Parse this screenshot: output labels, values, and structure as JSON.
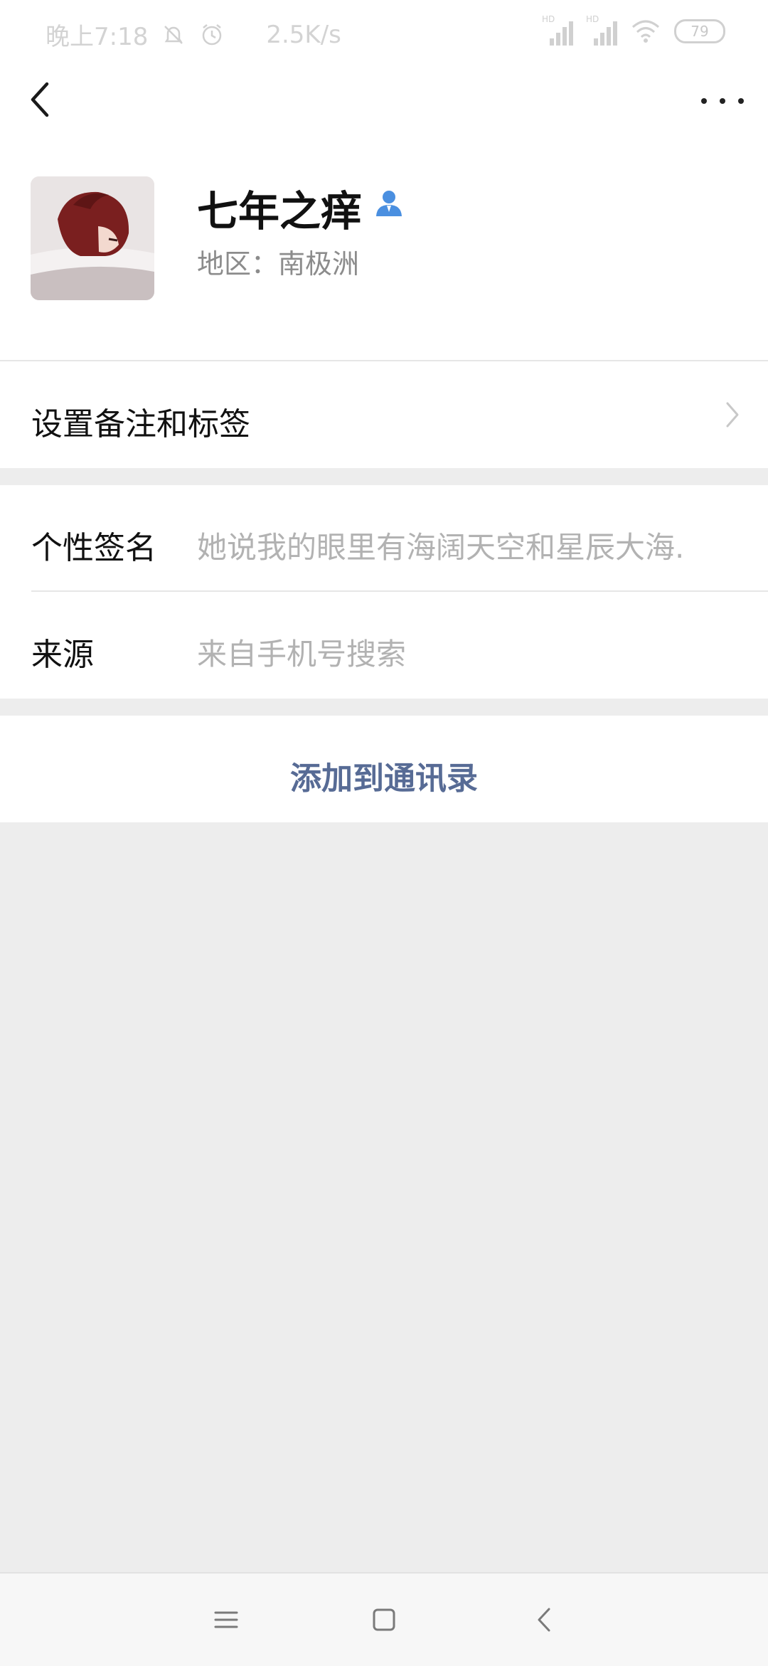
{
  "status_bar": {
    "time": "晚上7:18",
    "net_speed": "2.5K/s",
    "signal_1_label": "HD",
    "signal_2_label": "HD",
    "battery": "79",
    "icons": [
      "mute-bell-icon",
      "alarm-icon",
      "signal-icon",
      "wifi-icon",
      "battery-icon"
    ]
  },
  "header": {
    "back_icon": "chevron-left-icon",
    "more_icon": "more-dots-icon"
  },
  "profile": {
    "name": "七年之痒",
    "region": "地区：南极洲",
    "badge_icon": "person-icon",
    "avatar": "avatar-image"
  },
  "cells": {
    "remark_label": "设置备注和标签",
    "signature_label": "个性签名",
    "signature_value": "她说我的眼里有海阔天空和星辰大海.",
    "source_label": "来源",
    "source_value": "来自手机号搜索"
  },
  "actions": {
    "add_contact": "添加到通讯录"
  },
  "system_nav": {
    "icons": [
      "menu-icon",
      "home-icon",
      "back-icon"
    ]
  },
  "colors": {
    "link": "#576b95",
    "background": "#ededed",
    "badge": "#4a8fe0"
  }
}
